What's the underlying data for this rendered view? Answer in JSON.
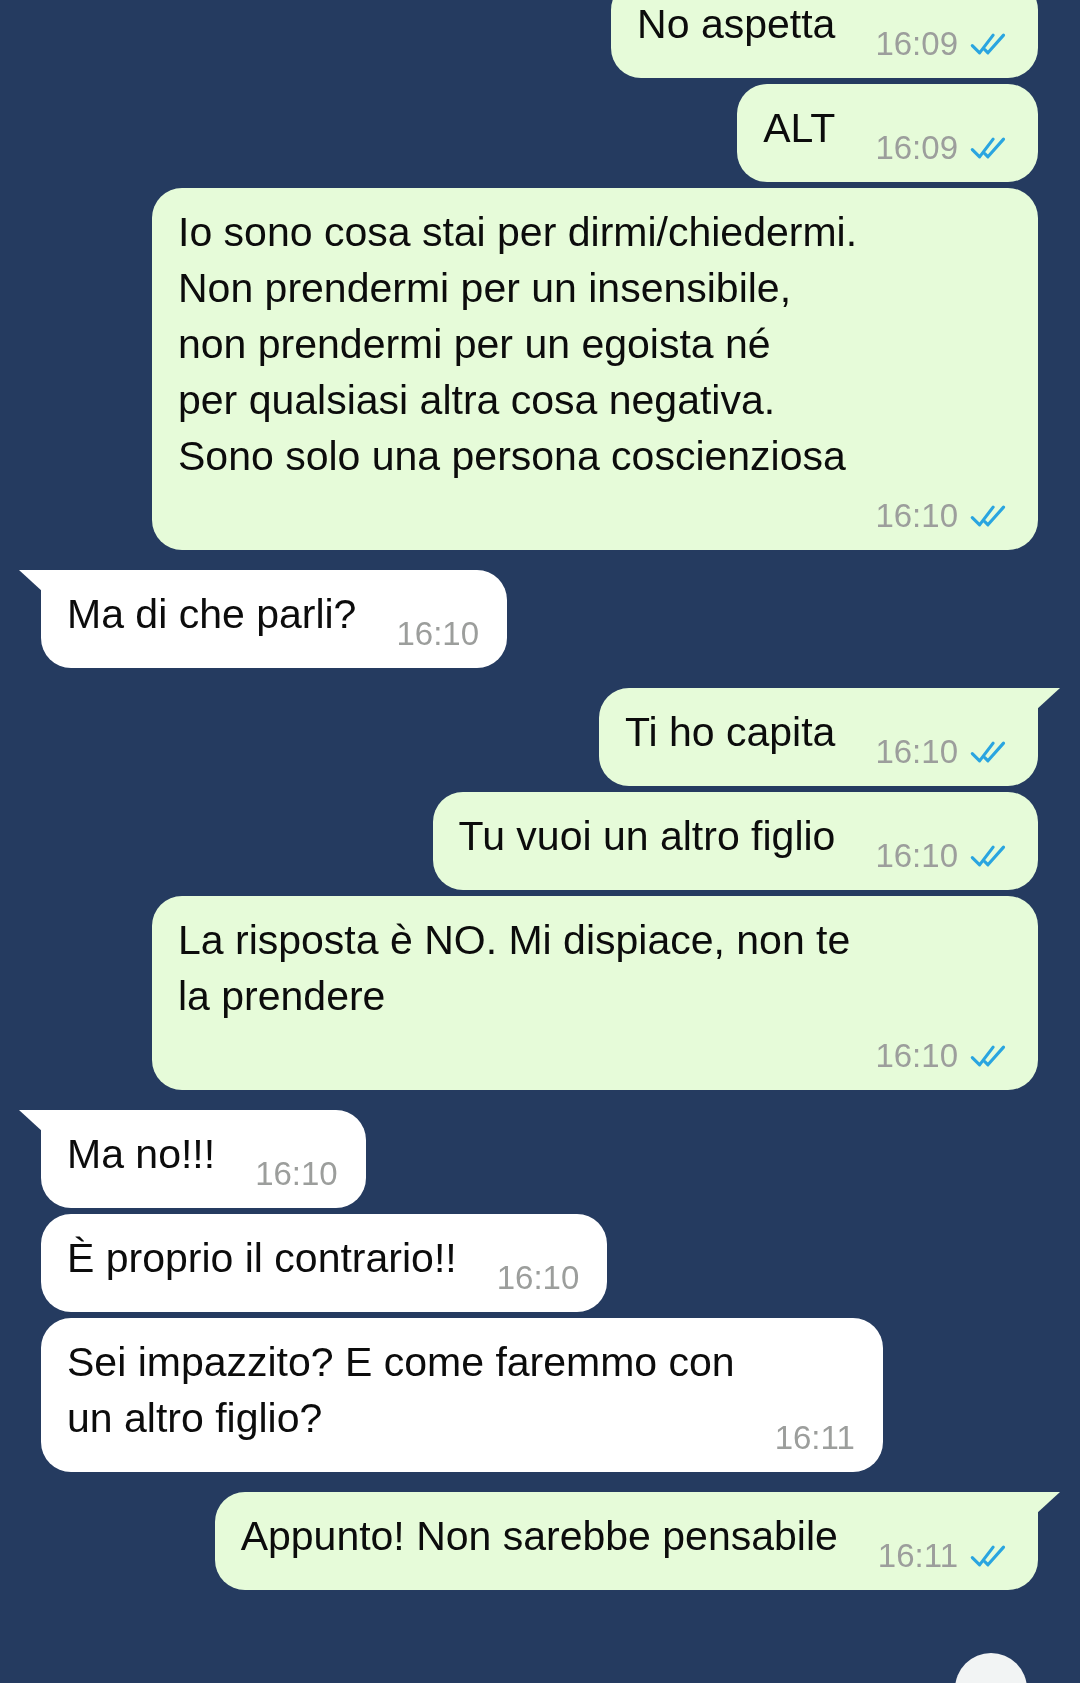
{
  "messages": [
    {
      "kind": "sent",
      "tail": false,
      "text": "No aspetta",
      "time": "16:09",
      "read": true
    },
    {
      "kind": "sent",
      "tail": false,
      "text": "ALT",
      "time": "16:09",
      "read": true
    },
    {
      "kind": "sent",
      "tail": false,
      "text": "Io sono cosa stai per dirmi/chiedermi.\nNon prendermi per un insensibile,\nnon prendermi per un egoista né\nper qualsiasi altra cosa negativa.\nSono solo una persona coscienziosa",
      "time": "16:10",
      "read": true
    },
    {
      "kind": "received",
      "tail": true,
      "text": "Ma di che parli?",
      "time": "16:10"
    },
    {
      "kind": "sent",
      "tail": true,
      "text": "Ti ho capita",
      "time": "16:10",
      "read": true
    },
    {
      "kind": "sent",
      "tail": false,
      "text": "Tu vuoi un altro figlio",
      "time": "16:10",
      "read": true
    },
    {
      "kind": "sent",
      "tail": false,
      "text": "La risposta è NO. Mi dispiace, non te\nla prendere",
      "time": "16:10",
      "read": true
    },
    {
      "kind": "received",
      "tail": true,
      "text": "Ma no!!!",
      "time": "16:10"
    },
    {
      "kind": "received",
      "tail": false,
      "text": "È proprio il contrario!!",
      "time": "16:10"
    },
    {
      "kind": "received",
      "tail": false,
      "text": "Sei impazzito? E come faremmo con\nun altro figlio?",
      "time": "16:11"
    },
    {
      "kind": "sent",
      "tail": true,
      "text": "Appunto! Non sarebbe pensabile",
      "time": "16:11",
      "read": true
    }
  ]
}
